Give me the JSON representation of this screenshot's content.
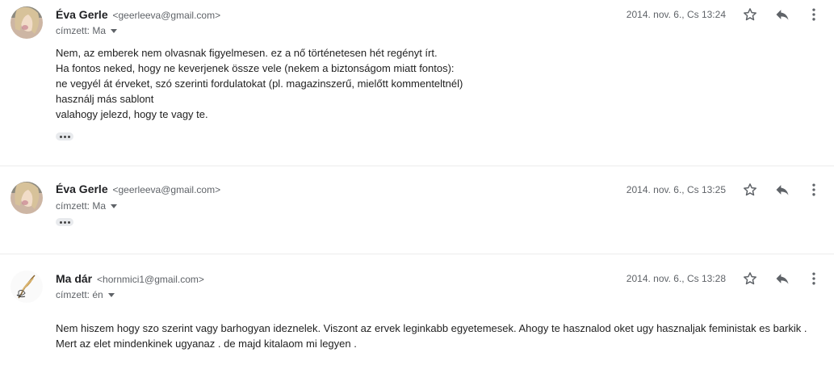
{
  "messages": [
    {
      "sender_name": "Éva Gerle",
      "sender_email": "<geerleeva@gmail.com>",
      "to_label": "címzett: Ma",
      "date": "2014. nov. 6., Cs 13:24",
      "body_lines": [
        "Nem, az emberek nem olvasnak figyelmesen. ez a nő történetesen hét regényt írt.",
        "Ha fontos neked, hogy ne keverjenek össze vele (nekem a biztonságom miatt fontos):",
        "ne vegyél át érveket, szó szerinti fordulatokat (pl. magazinszerű, mielőtt kommenteltnél)",
        "használj más sablont",
        "valahogy jelezd, hogy te vagy te."
      ],
      "avatar_icon": "profile-photo-girl"
    },
    {
      "sender_name": "Éva Gerle",
      "sender_email": "<geerleeva@gmail.com>",
      "to_label": "címzett: Ma",
      "date": "2014. nov. 6., Cs 13:25",
      "avatar_icon": "profile-photo-girl"
    },
    {
      "sender_name": "Ma dár",
      "sender_email": "<hornmici1@gmail.com>",
      "to_label": "címzett: én",
      "date": "2014. nov. 6., Cs 13:28",
      "body_lines": [
        "Nem hiszem hogy szo szerint vagy barhogyan ideznelek. Viszont az ervek leginkabb egyetemesek. Ahogy te hasznalod oket ugy hasznaljak feministak es barkik .",
        "Mert az elet mindenkinek ugyanaz . de majd kitalaom mi legyen ."
      ],
      "avatar_icon": "feather-logo"
    }
  ],
  "icons": {
    "star": "star-outline-icon",
    "reply": "reply-icon",
    "more": "more-vert-icon"
  }
}
